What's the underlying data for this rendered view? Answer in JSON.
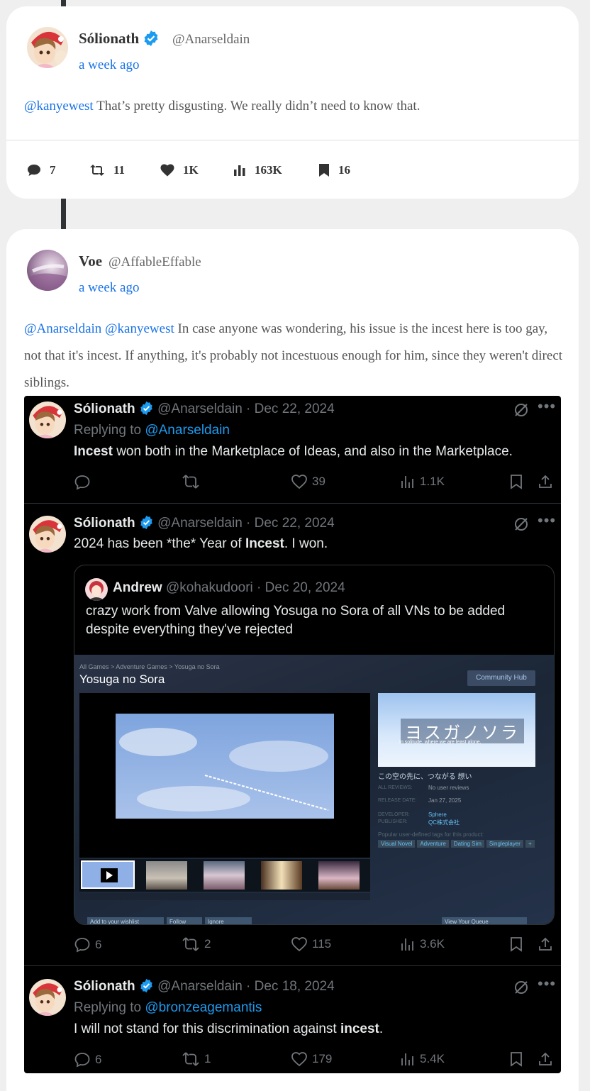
{
  "post1": {
    "name": "Sólionath",
    "handle": "@Anarseldain",
    "time": "a week ago",
    "mention": "@kanyewest",
    "text": " That’s pretty disgusting. We really didn’t need to know that.",
    "stats": {
      "replies": "7",
      "reposts": "11",
      "likes": "1K",
      "views": "163K",
      "bookmarks": "16"
    }
  },
  "post2": {
    "name": "Voe",
    "handle": "@AffableEffable",
    "time": "a week ago",
    "mention1": "@Anarseldain",
    "mention2": "@kanyewest",
    "text": " In case anyone was wondering, his issue is the incest here is too gay, not that it's incest. If anything, it's probably not incestuous enough for him, since they weren't direct siblings."
  },
  "embed": {
    "tweet1": {
      "name": "Sólionath",
      "meta": " @Anarseldain · Dec 22, 2024",
      "replying_prefix": "Replying to ",
      "replying_to": "@Anarseldain",
      "bold": "Incest",
      "text": " won both in the Marketplace of Ideas, and also in the Marketplace.",
      "likes": "39",
      "views": "1.1K"
    },
    "tweet2": {
      "name": "Sólionath",
      "meta": " @Anarseldain · Dec 22, 2024",
      "text_a": "2024 has been *the* Year of ",
      "bold": "Incest",
      "text_b": ". I won.",
      "replies": "6",
      "reposts": "2",
      "likes": "115",
      "views": "3.6K",
      "quote": {
        "name": "Andrew",
        "meta": " @kohakudoori · Dec 20, 2024",
        "line1": "crazy work from Valve allowing Yosuga no Sora of all VNs to be added",
        "line2": "despite everything they've rejected",
        "steam": {
          "breadcrumb": "All Games > Adventure Games > Yosuga no Sora",
          "title": "Yosuga no Sora",
          "community_hub": "Community Hub",
          "logo_text": "ヨスガノソラ",
          "logo_sub": "In solitude, where we are least alone.",
          "tagline": "この空の先に、つながる 想い",
          "all_reviews_label": "ALL REVIEWS:",
          "all_reviews_value": "No user reviews",
          "release_label": "RELEASE DATE:",
          "release_value": "Jan 27, 2025",
          "developer_label": "DEVELOPER:",
          "developer_value": "Sphere",
          "publisher_label": "PUBLISHER:",
          "publisher_value": "QC株式会社",
          "tags_label": "Popular user-defined tags for this product:",
          "tags": [
            "Visual Novel",
            "Adventure",
            "Dating Sim",
            "Singleplayer",
            "+"
          ],
          "bottom_btns": [
            "Add to your wishlist",
            "Follow",
            "Ignore",
            "View Your Queue"
          ]
        }
      }
    },
    "tweet3": {
      "name": "Sólionath",
      "meta": " @Anarseldain · Dec 18, 2024",
      "replying_prefix": "Replying to ",
      "replying_to": "@bronzeagemantis",
      "text_a": "I will not stand for this discrimination against ",
      "bold": "incest",
      "text_b": ".",
      "replies": "6",
      "reposts": "1",
      "likes": "179",
      "views": "5.4K"
    }
  }
}
